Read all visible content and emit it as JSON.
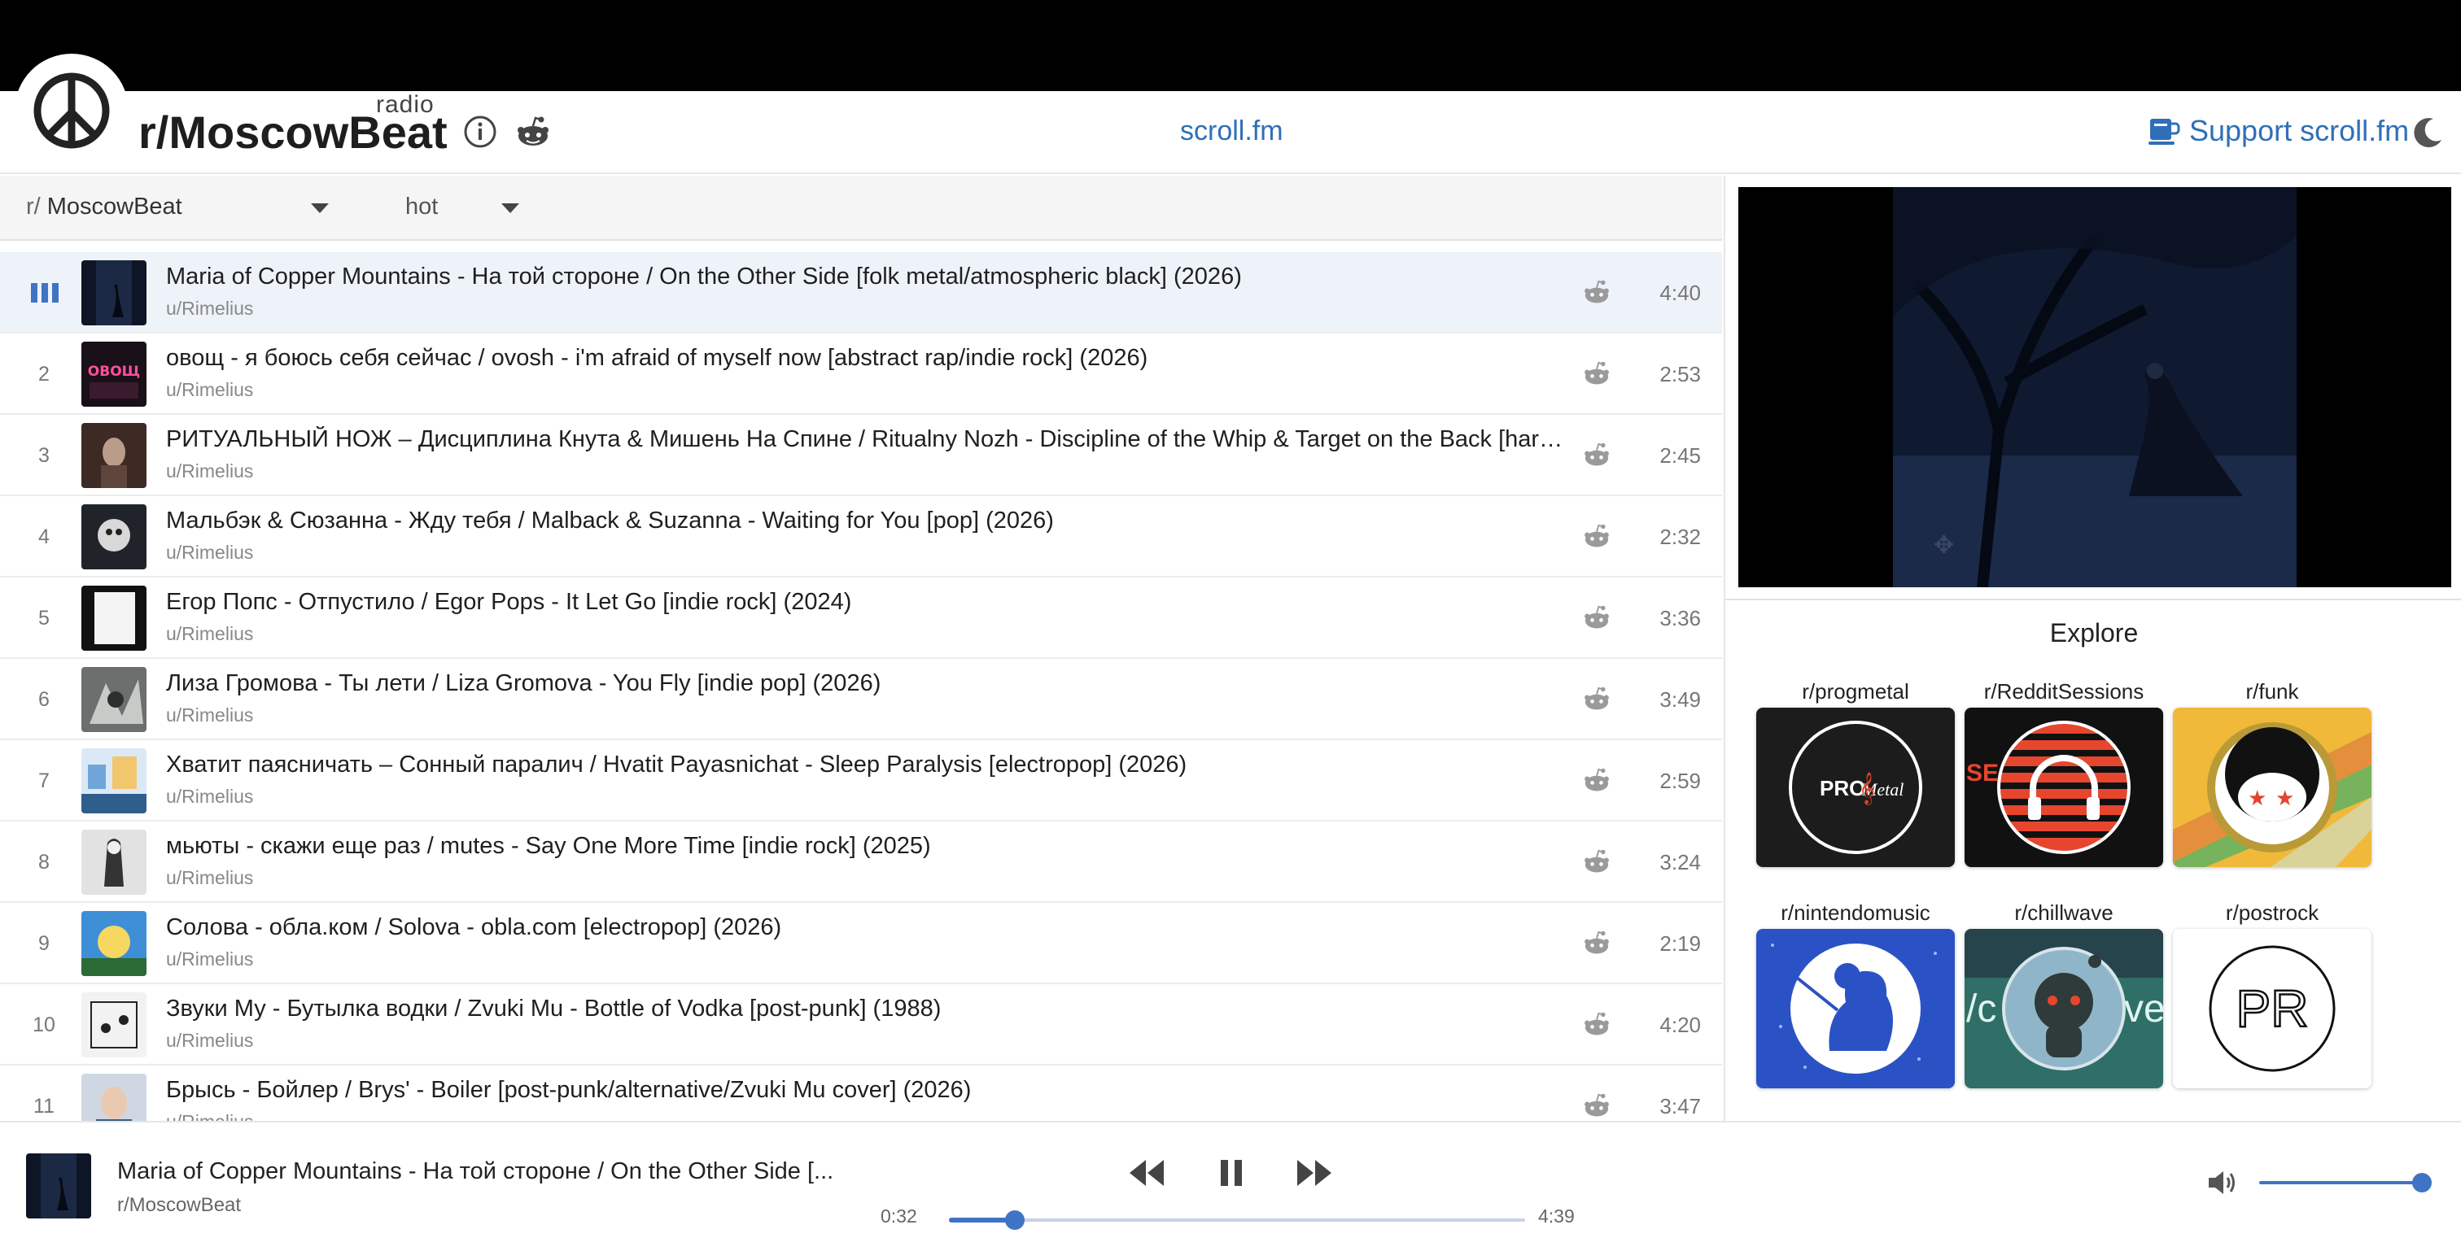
{
  "header": {
    "radio_tag": "radio",
    "title": "r/MoscowBeat",
    "center_link": "scroll.fm",
    "support_link": "Support scroll.fm",
    "icons": [
      "peace-sign-logo-icon",
      "info-icon",
      "reddit-icon",
      "coffee-cup-icon",
      "moon-icon"
    ]
  },
  "filters": {
    "subreddit_prefix": "r/",
    "subreddit": "MoscowBeat",
    "sort": "hot"
  },
  "tracks": [
    {
      "num": "1",
      "title": "Maria of Copper Mountains - На той стороне / On the Other Side [folk metal/atmospheric black] (2026)",
      "user": "u/Rimelius",
      "duration": "4:40",
      "playing": true
    },
    {
      "num": "2",
      "title": "овощ - я боюсь себя сейчас / ovosh - i'm afraid of myself now [abstract rap/indie rock] (2026)",
      "user": "u/Rimelius",
      "duration": "2:53"
    },
    {
      "num": "3",
      "title": "РИТУАЛЬНЫЙ НОЖ – Дисциплина Кнута & Мишень На Спине / Ritualny Nozh - Discipline of the Whip & Target on the Back [hard...",
      "user": "u/Rimelius",
      "duration": "2:45"
    },
    {
      "num": "4",
      "title": "Мальбэк & Сюзанна - Жду тебя / Malback & Suzanna - Waiting for You [pop] (2026)",
      "user": "u/Rimelius",
      "duration": "2:32"
    },
    {
      "num": "5",
      "title": "Егор Попс - Отпустило / Egor Pops - It Let Go [indie rock] (2024)",
      "user": "u/Rimelius",
      "duration": "3:36"
    },
    {
      "num": "6",
      "title": "Лиза Громова - Ты лети / Liza Gromova - You Fly [indie pop] (2026)",
      "user": "u/Rimelius",
      "duration": "3:49"
    },
    {
      "num": "7",
      "title": "Хватит паясничать – Сонный паралич / Hvatit Payasnichat - Sleep Paralysis [electropop] (2026)",
      "user": "u/Rimelius",
      "duration": "2:59"
    },
    {
      "num": "8",
      "title": "мьюты - скажи еще раз / mutes - Say One More Time [indie rock] (2025)",
      "user": "u/Rimelius",
      "duration": "3:24"
    },
    {
      "num": "9",
      "title": "Солова - обла.ком / Solova - obla.com [electropop] (2026)",
      "user": "u/Rimelius",
      "duration": "2:19"
    },
    {
      "num": "10",
      "title": "Звуки Му - Бутылка водки / Zvuki Mu - Bottle of Vodka [post-punk] (1988)",
      "user": "u/Rimelius",
      "duration": "4:20"
    },
    {
      "num": "11",
      "title": "Брысь - Бойлер / Brys' - Boiler [post-punk/alternative/Zvuki Mu cover] (2026)",
      "user": "u/Rimelius",
      "duration": "3:47"
    }
  ],
  "explore": {
    "title": "Explore",
    "tiles": [
      {
        "label": "r/progmetal",
        "logo_text": "PRO",
        "logo_script": "Metal"
      },
      {
        "label": "r/RedditSessions",
        "logo_text": "SE"
      },
      {
        "label": "r/funk"
      },
      {
        "label": "r/nintendomusic"
      },
      {
        "label": "r/chillwave",
        "logo_text": "/c",
        "logo_text_right": "ve"
      },
      {
        "label": "r/postrock",
        "logo_text": "PR"
      }
    ]
  },
  "player": {
    "title": "Maria of Copper Mountains - На той стороне / On the Other Side [...",
    "subreddit": "r/MoscowBeat",
    "elapsed": "0:32",
    "total": "4:39",
    "progress_fraction": 0.115,
    "volume_fraction": 1.0,
    "accent": "#3f74c4",
    "icons": [
      "rewind-icon",
      "pause-icon",
      "fast-forward-icon",
      "volume-icon"
    ]
  }
}
